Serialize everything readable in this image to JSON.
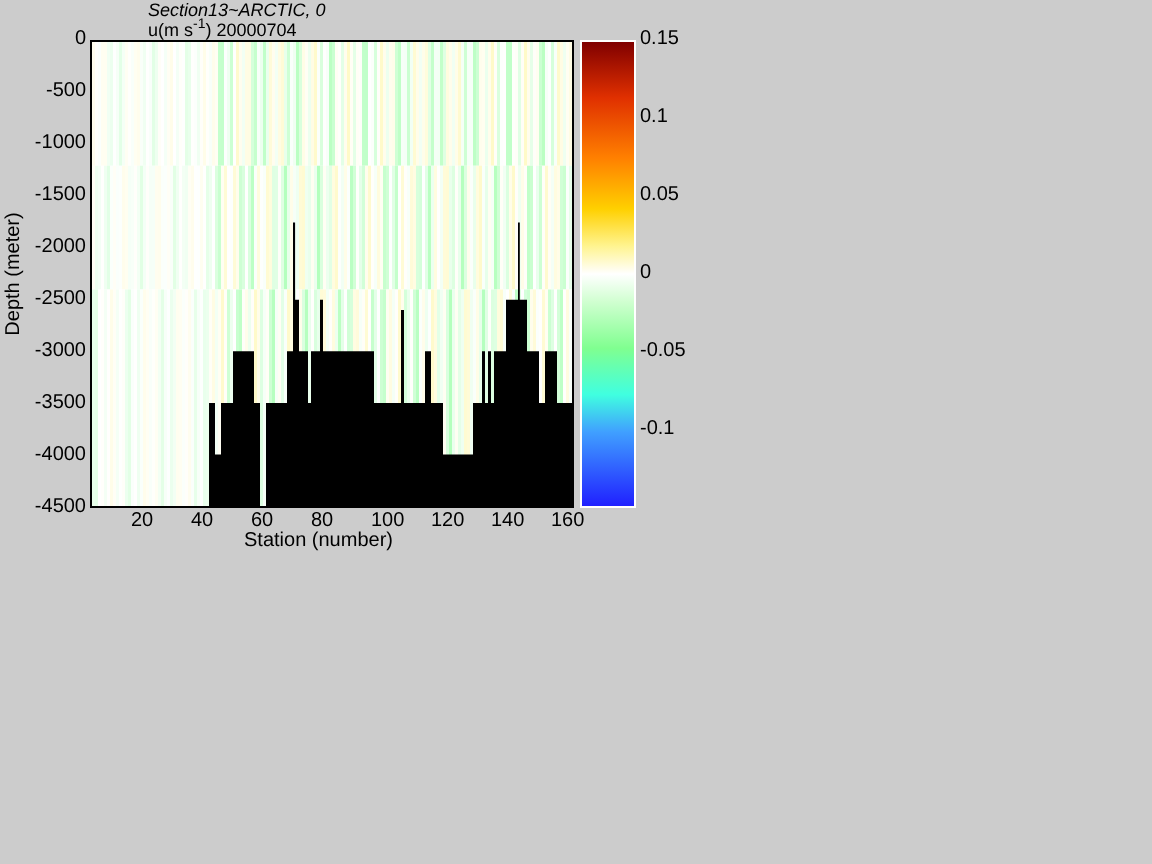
{
  "title": {
    "line_1": "Section13~ARCTIC, 0",
    "line_2": "u(m s$^{-1}$) 20000704"
  },
  "y_axis": {
    "label": "Depth (meter)",
    "ticks": [
      "0",
      "-500",
      "-1000",
      "-1500",
      "-2000",
      "-2500",
      "-3000",
      "-3500",
      "-4000",
      "-4500"
    ]
  },
  "x_axis": {
    "label": "Station (number)",
    "ticks": [
      "20",
      "40",
      "60",
      "80",
      "100",
      "120",
      "140",
      "160"
    ]
  },
  "colorbar": {
    "ticks": [
      "0.15",
      "0.1",
      "0.05",
      "0",
      "-0.05",
      "-0.1"
    ]
  }
}
